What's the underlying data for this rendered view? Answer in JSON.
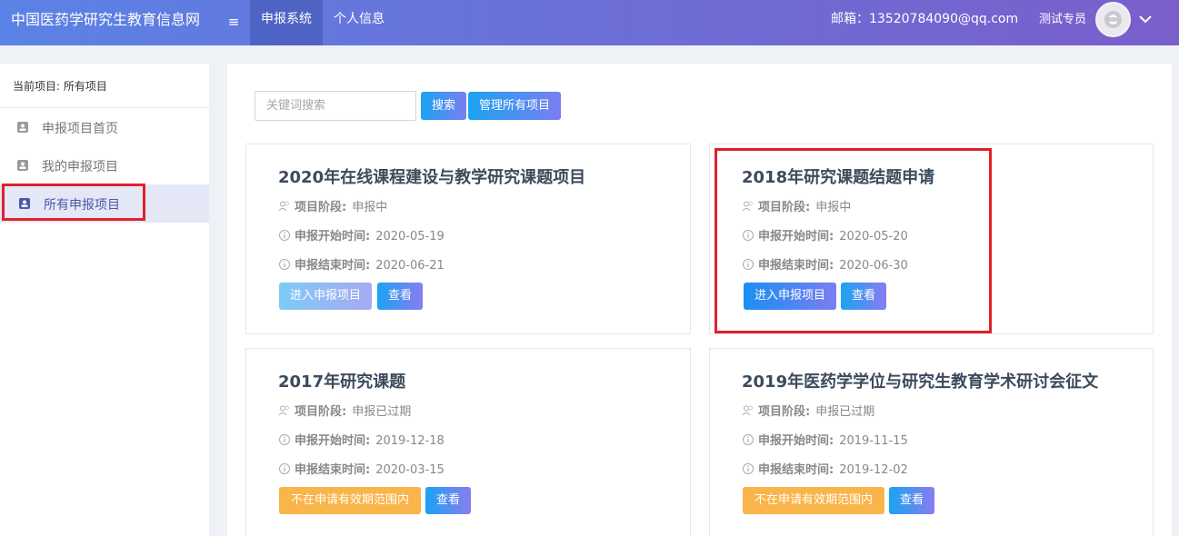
{
  "header": {
    "brand": "中国医药学研究生教育信息网",
    "menu_icon": "≡",
    "tabs": [
      "申报系统",
      "个人信息"
    ],
    "email": "邮箱：13520784090@qq.com",
    "username": "测试专员"
  },
  "sidebar": {
    "current_project": "当前项目: 所有项目",
    "items": [
      {
        "label": "申报项目首页",
        "icon": "user-badge-icon"
      },
      {
        "label": "我的申报项目",
        "icon": "user-badge-icon"
      },
      {
        "label": "所有申报项目",
        "icon": "user-badge-icon",
        "active": true
      }
    ]
  },
  "search": {
    "placeholder": "关键词搜索",
    "value": "",
    "search_label": "搜索",
    "manage_label": "管理所有项目"
  },
  "cards": [
    {
      "title": "2020年在线课程建设与教学研究课题项目",
      "stage_label": "项目阶段:",
      "stage": "申报中",
      "start_label": "申报开始时间:",
      "start": "2020-05-19",
      "end_label": "申报结束时间:",
      "end": "2020-06-21",
      "primary_label": "进入申报项目",
      "view_label": "查看"
    },
    {
      "title": "2018年研究课题结题申请",
      "stage_label": "项目阶段:",
      "stage": "申报中",
      "start_label": "申报开始时间:",
      "start": "2020-05-20",
      "end_label": "申报结束时间:",
      "end": "2020-06-30",
      "primary_label": "进入申报项目",
      "view_label": "查看"
    },
    {
      "title": "2017年研究课题",
      "stage_label": "项目阶段:",
      "stage": "申报已过期",
      "start_label": "申报开始时间:",
      "start": "2019-12-18",
      "end_label": "申报结束时间:",
      "end": "2020-03-15",
      "primary_label": "不在申请有效期范围内",
      "view_label": "查看"
    },
    {
      "title": "2019年医药学学位与研究生教育学术研讨会征文",
      "stage_label": "项目阶段:",
      "stage": "申报已过期",
      "start_label": "申报开始时间:",
      "start": "2019-11-15",
      "end_label": "申报结束时间:",
      "end": "2019-12-02",
      "primary_label": "不在申请有效期范围内",
      "view_label": "查看"
    }
  ],
  "colors": {
    "header_start": "#5b82e6",
    "header_end": "#7a5fcb",
    "highlight": "#e0202a",
    "expired_button": "#f9b54a"
  }
}
